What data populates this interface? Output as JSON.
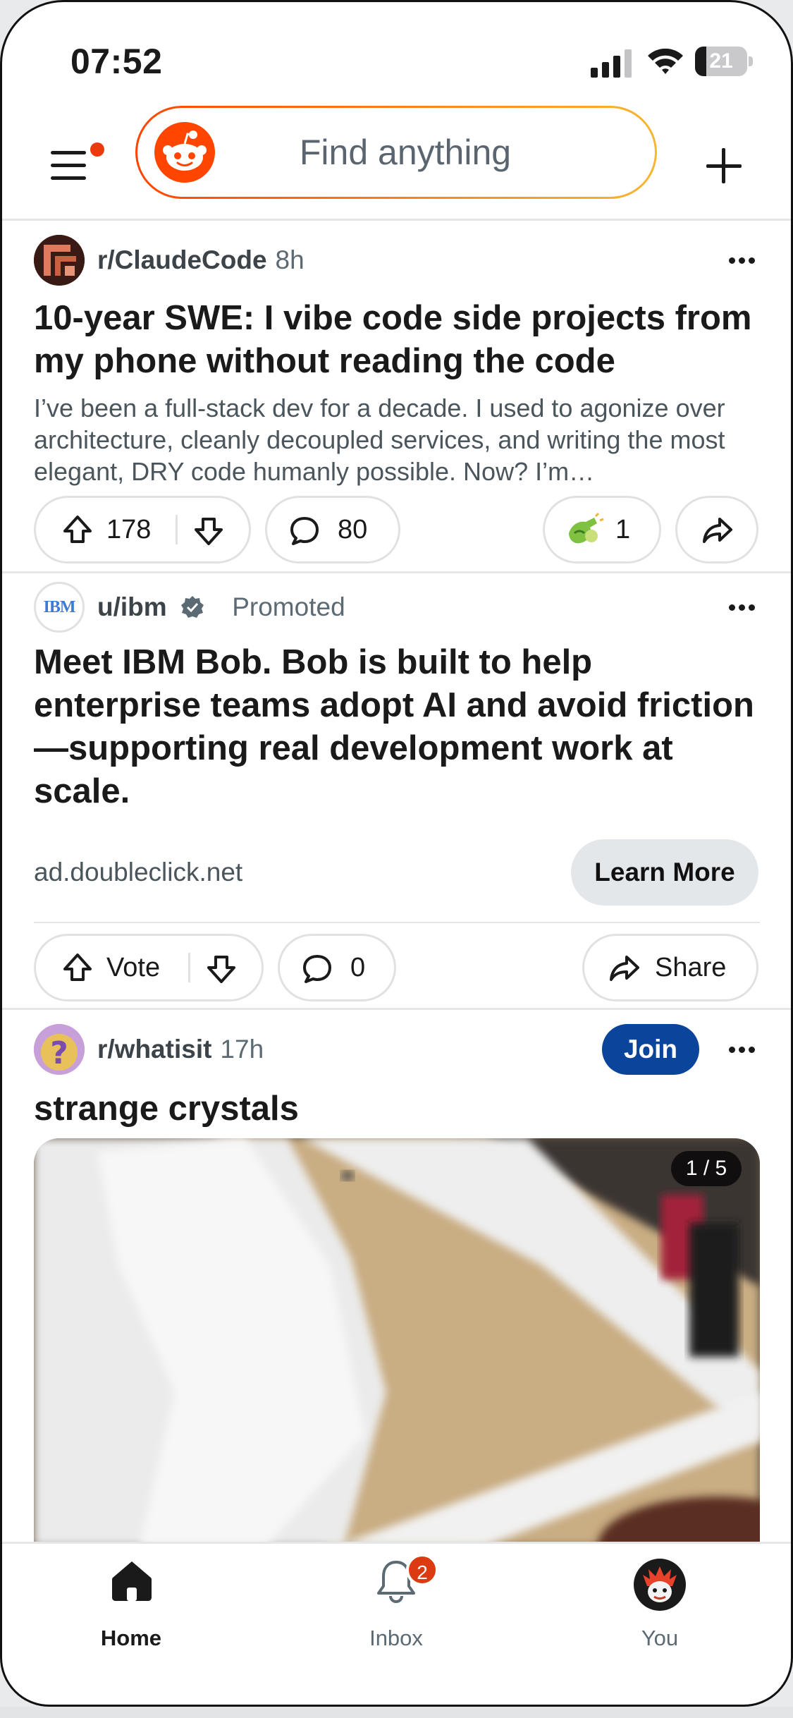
{
  "status_bar": {
    "time": "07:52",
    "battery": "21",
    "battery_level": 0.21
  },
  "header": {
    "search_placeholder": "Find anything"
  },
  "posts": [
    {
      "subreddit": "r/ClaudeCode",
      "age": "8h",
      "title": "10-year SWE: I vibe code side projects from my phone without reading the code",
      "excerpt": "I’ve been a full-stack dev for a decade. I used to agonize over architecture, cleanly decoupled services, and writing the most elegant, DRY code humanly possible. Now? I’m…",
      "upvotes": "178",
      "comments": "80",
      "awards": "1"
    },
    {
      "author": "u/ibm",
      "promoted_label": "Promoted",
      "title": "Meet IBM Bob. Bob is built to help enterprise teams adopt AI and avoid friction—supporting real development work at scale.",
      "domain": "ad.doubleclick.net",
      "cta": "Learn More",
      "vote_label": "Vote",
      "comments": "0",
      "share_label": "Share",
      "avatar_text": "IBM"
    },
    {
      "subreddit": "r/whatisit",
      "age": "17h",
      "join_label": "Join",
      "title": "strange crystals",
      "gallery_counter": "1 / 5"
    }
  ],
  "tabbar": {
    "home": "Home",
    "inbox": "Inbox",
    "inbox_badge": "2",
    "you": "You"
  },
  "colors": {
    "accent": "#ff4500",
    "join": "#0a449b",
    "badge": "#dc3a10"
  }
}
